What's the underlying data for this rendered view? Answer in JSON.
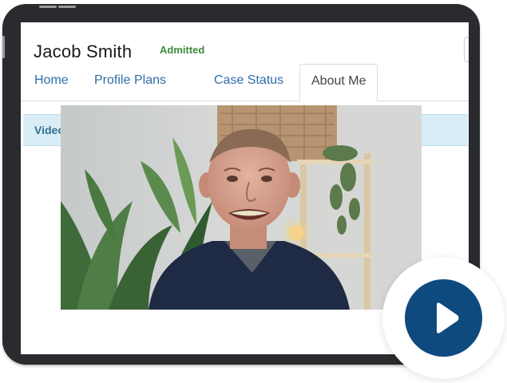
{
  "header": {
    "patient_name": "Jacob Smith",
    "status": "Admitted"
  },
  "tabs": [
    {
      "label": "Home",
      "active": false
    },
    {
      "label": "Profile",
      "active": false
    },
    {
      "label": "Plans",
      "active": false
    },
    {
      "label": "Case Status",
      "active": false
    },
    {
      "label": "About Me",
      "active": true
    }
  ],
  "video_section": {
    "heading": "Video"
  },
  "icons": {
    "play": "play-icon"
  },
  "colors": {
    "link": "#2f6ea8",
    "status": "#3f8a3a",
    "panel_heading_bg": "#d9edf7",
    "panel_heading_text": "#31708f",
    "play_button": "#0f4a7e"
  }
}
